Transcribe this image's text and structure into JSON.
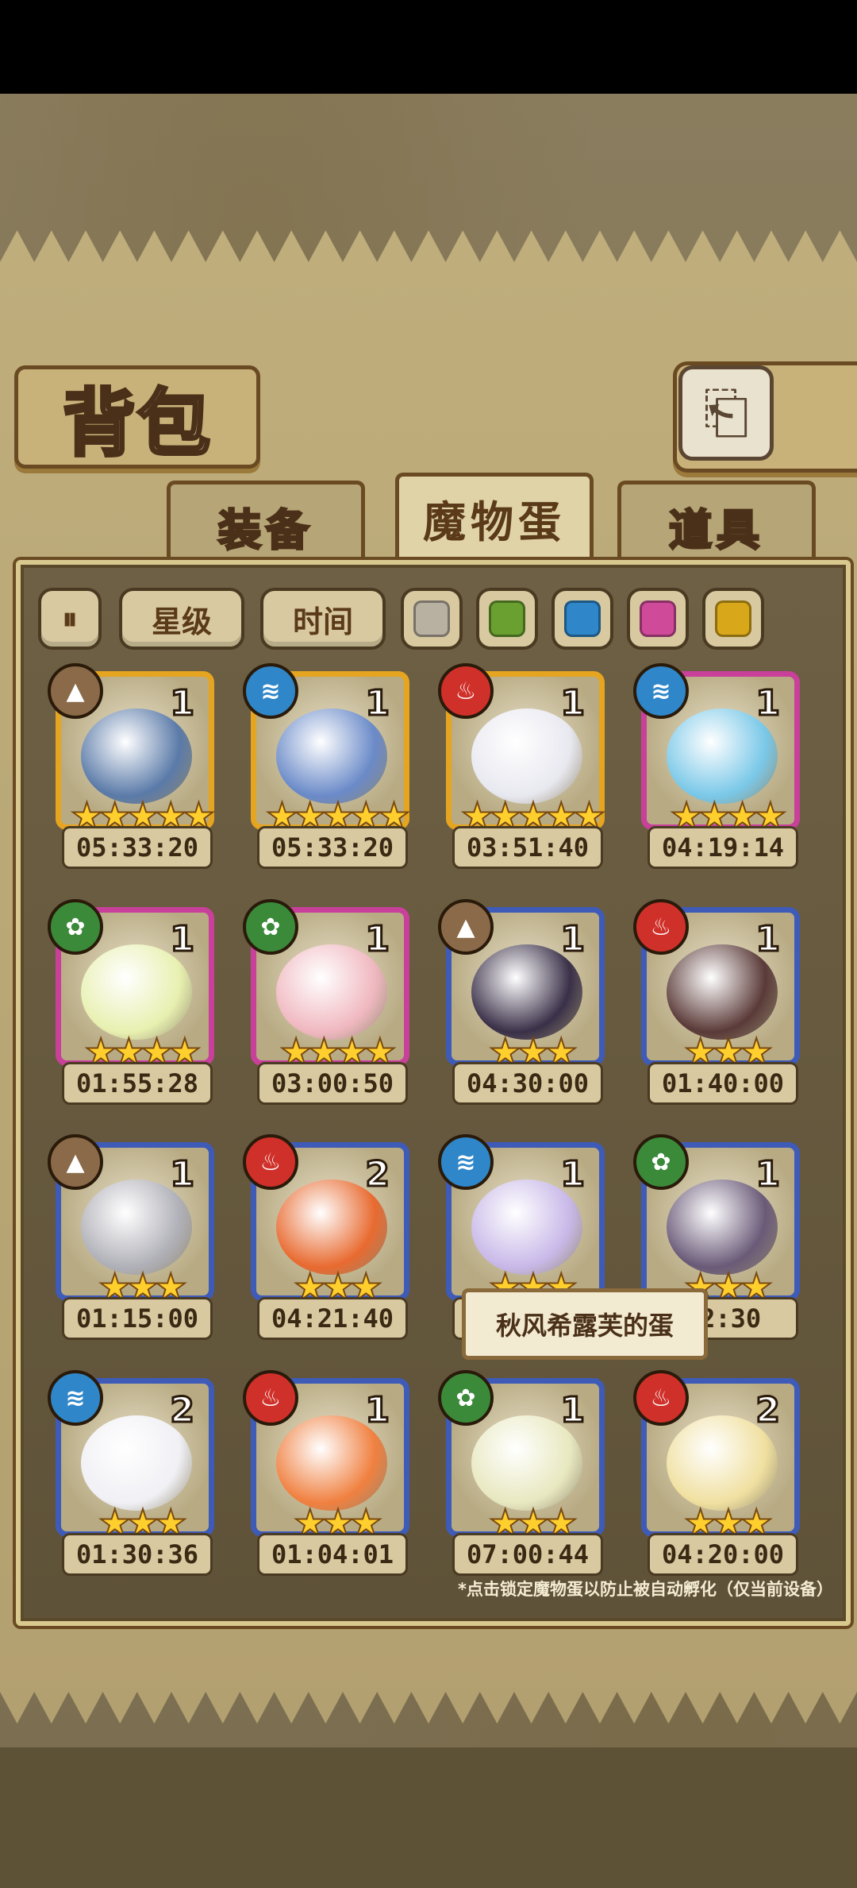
{
  "header": {
    "title": "背包",
    "back_icon": "⎗"
  },
  "tabs": [
    {
      "label": "装备",
      "active": false
    },
    {
      "label": "魔物蛋",
      "active": true
    },
    {
      "label": "道具",
      "active": false
    }
  ],
  "filters": {
    "sort_toggle_icon": "⏸",
    "star_label": "星级",
    "time_label": "时间",
    "rarity_colors": [
      "#b8b0a0",
      "#6aa030",
      "#2f86c8",
      "#d04a9a",
      "#d8a81a"
    ]
  },
  "element_colors": {
    "earth": "#8a6a48",
    "water": "#2f86c8",
    "fire": "#d0302a",
    "wood": "#3a8a3a"
  },
  "element_glyphs": {
    "earth": "▲",
    "water": "≋",
    "fire": "♨",
    "wood": "✿"
  },
  "frame_colors": {
    "gold": "#e5a520",
    "pink": "#c8409a",
    "blue": "#3f5bb8"
  },
  "eggs": [
    {
      "element": "earth",
      "frame": "gold",
      "count": "1",
      "stars": "★★★★★",
      "timer": "05:33:20",
      "color": "#5a7aa8"
    },
    {
      "element": "water",
      "frame": "gold",
      "count": "1",
      "stars": "★★★★★",
      "timer": "05:33:20",
      "color": "#6a8ac8"
    },
    {
      "element": "fire",
      "frame": "gold",
      "count": "1",
      "stars": "★★★★★",
      "timer": "03:51:40",
      "color": "#e8e8f0"
    },
    {
      "element": "water",
      "frame": "pink",
      "count": "1",
      "stars": "★★★★",
      "timer": "04:19:14",
      "color": "#7ac8e8"
    },
    {
      "element": "wood",
      "frame": "pink",
      "count": "1",
      "stars": "★★★★",
      "timer": "01:55:28",
      "color": "#e8f0b0"
    },
    {
      "element": "wood",
      "frame": "pink",
      "count": "1",
      "stars": "★★★★",
      "timer": "03:00:50",
      "color": "#f0b8c0"
    },
    {
      "element": "earth",
      "frame": "blue",
      "count": "1",
      "stars": "★★★",
      "timer": "04:30:00",
      "color": "#3a3048"
    },
    {
      "element": "fire",
      "frame": "blue",
      "count": "1",
      "stars": "★★★",
      "timer": "01:40:00",
      "color": "#5a3a38"
    },
    {
      "element": "earth",
      "frame": "blue",
      "count": "1",
      "stars": "★★★",
      "timer": "01:15:00",
      "color": "#b0b0b8"
    },
    {
      "element": "fire",
      "frame": "blue",
      "count": "2",
      "stars": "★★★",
      "timer": "04:21:40",
      "color": "#e86a30"
    },
    {
      "element": "water",
      "frame": "blue",
      "count": "1",
      "stars": "★★★",
      "timer": "",
      "color": "#c8b8e8"
    },
    {
      "element": "wood",
      "frame": "blue",
      "count": "1",
      "stars": "★★★",
      "timer": "32:30",
      "color": "#6a5a78"
    },
    {
      "element": "water",
      "frame": "blue",
      "count": "2",
      "stars": "★★★",
      "timer": "01:30:36",
      "color": "#f0f0f5"
    },
    {
      "element": "fire",
      "frame": "blue",
      "count": "1",
      "stars": "★★★",
      "timer": "01:04:01",
      "color": "#f08040"
    },
    {
      "element": "wood",
      "frame": "blue",
      "count": "1",
      "stars": "★★★",
      "timer": "07:00:44",
      "color": "#e8e8c0"
    },
    {
      "element": "fire",
      "frame": "blue",
      "count": "2",
      "stars": "★★★",
      "timer": "04:20:00",
      "color": "#f0e0a0"
    }
  ],
  "tooltip": "秋风希露芙的蛋",
  "footer_note": "*点击锁定魔物蛋以防止被自动孵化（仅当前设备）"
}
